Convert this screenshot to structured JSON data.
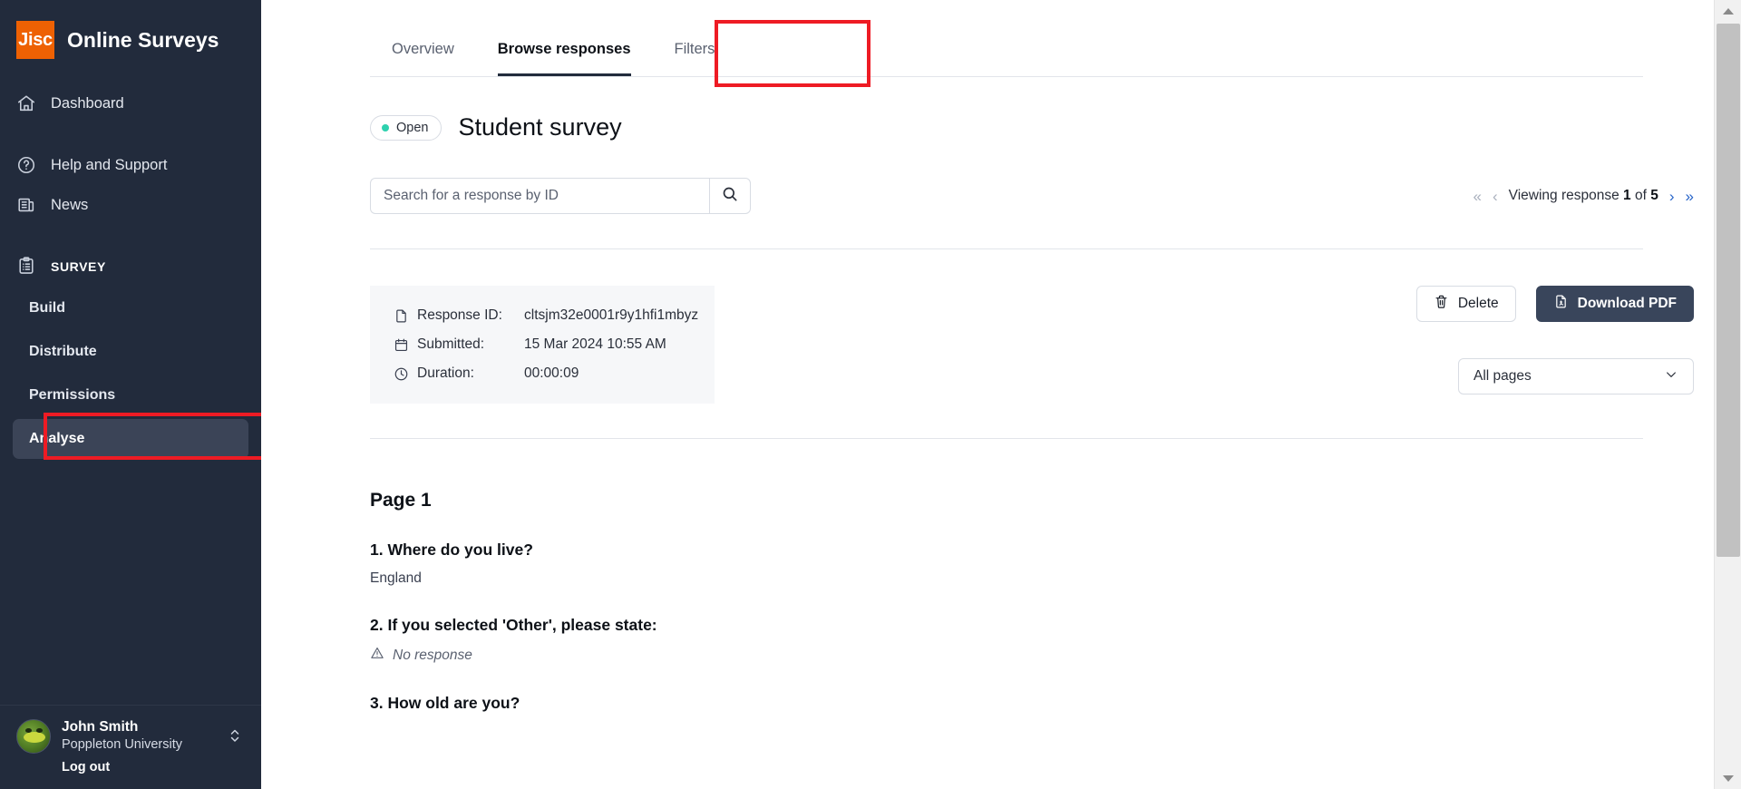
{
  "brand": {
    "logo_text": "Jisc",
    "title": "Online Surveys",
    "logo_color": "#ee6103"
  },
  "sidebar": {
    "nav": [
      {
        "label": "Dashboard",
        "icon": "home-icon"
      },
      {
        "label": "Help and Support",
        "icon": "question-circle-icon"
      },
      {
        "label": "News",
        "icon": "newspaper-icon"
      }
    ],
    "section": {
      "label": "SURVEY",
      "icon": "clipboard-icon"
    },
    "sub_items": [
      {
        "label": "Build",
        "active": false
      },
      {
        "label": "Distribute",
        "active": false
      },
      {
        "label": "Permissions",
        "active": false
      },
      {
        "label": "Analyse",
        "active": true
      }
    ],
    "user": {
      "name": "John Smith",
      "org": "Poppleton University",
      "logout": "Log out",
      "switcher_icon": "chevron-up-down-icon",
      "avatar": "user-avatar"
    }
  },
  "tabs": [
    {
      "label": "Overview",
      "active": false
    },
    {
      "label": "Browse responses",
      "active": true
    },
    {
      "label": "Filters",
      "active": false
    }
  ],
  "header": {
    "status_label": "Open",
    "status_color": "#2ed1ae",
    "survey_title": "Student survey"
  },
  "search": {
    "placeholder": "Search for a response by ID",
    "value": "",
    "button_icon": "search-icon"
  },
  "pager": {
    "first_icon": "«",
    "prev_icon": "‹",
    "text_prefix": "Viewing response",
    "current": "1",
    "of_word": "of",
    "total": "5",
    "next_icon": "›",
    "last_icon": "»"
  },
  "response": {
    "fields": [
      {
        "icon": "document-icon",
        "label": "Response ID:",
        "value": "cltsjm32e0001r9y1hfi1mbyz"
      },
      {
        "icon": "calendar-icon",
        "label": "Submitted:",
        "value": "15 Mar 2024 10:55 AM"
      },
      {
        "icon": "clock-icon",
        "label": "Duration:",
        "value": "00:00:09"
      }
    ],
    "delete_label": "Delete",
    "delete_icon": "trash-icon",
    "download_label": "Download PDF",
    "download_icon": "pdf-file-icon",
    "pages_select_value": "All pages",
    "pages_select_icon": "chevron-down-icon"
  },
  "content": {
    "page_label": "Page 1",
    "questions": [
      {
        "text": "1. Where do you live?",
        "answer": "England",
        "no_response": false
      },
      {
        "text": "2. If you selected 'Other', please state:",
        "answer": "No response",
        "no_response": true
      },
      {
        "text": "3. How old are you?",
        "answer": "",
        "no_response": false
      }
    ]
  },
  "scrollbar": {
    "up_icon": "triangle-up-icon",
    "down_icon": "triangle-down-icon"
  }
}
